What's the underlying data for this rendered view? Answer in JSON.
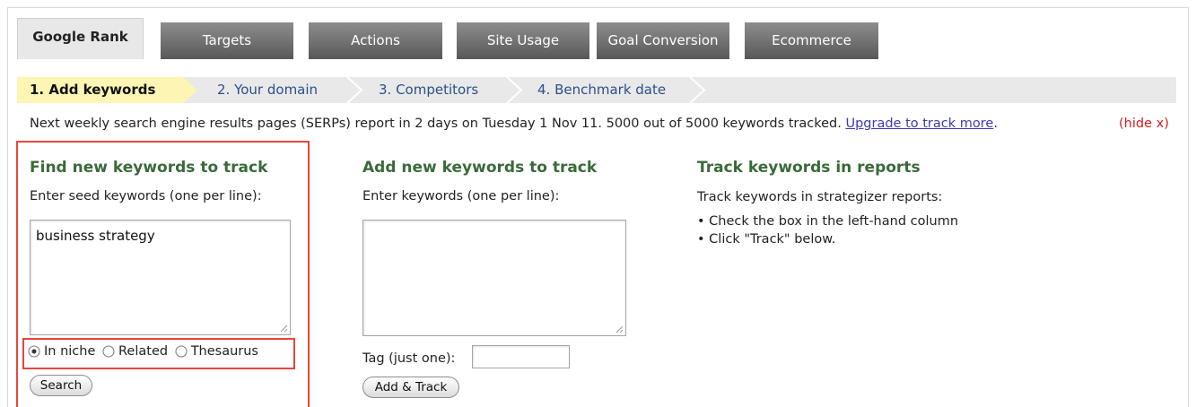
{
  "tabs": [
    {
      "label": "Google Rank",
      "active": true
    },
    {
      "label": "Targets",
      "active": false
    },
    {
      "label": "Actions",
      "active": false
    },
    {
      "label": "Site Usage",
      "active": false
    },
    {
      "label": "Goal Conversion",
      "active": false
    },
    {
      "label": "Ecommerce",
      "active": false
    }
  ],
  "steps": [
    {
      "label": "1. Add keywords",
      "active": true
    },
    {
      "label": "2. Your domain",
      "active": false
    },
    {
      "label": "3. Competitors",
      "active": false
    },
    {
      "label": "4. Benchmark date",
      "active": false
    }
  ],
  "notice": {
    "text": "Next weekly search engine results pages (SERPs) report in 2 days on Tuesday 1 Nov 11. 5000 out of 5000 keywords tracked.",
    "link": "Upgrade to track more",
    "trailing": ".",
    "hide": "(hide x)"
  },
  "find": {
    "title": "Find new keywords to track",
    "label": "Enter seed keywords (one per line):",
    "value": "business strategy",
    "options": [
      "In niche",
      "Related",
      "Thesaurus"
    ],
    "selected": "In niche",
    "button": "Search"
  },
  "add": {
    "title": "Add new keywords to track",
    "label": "Enter keywords (one per line):",
    "value": "",
    "tag_label": "Tag (just one):",
    "tag_value": "",
    "button": "Add & Track"
  },
  "track": {
    "title": "Track keywords in reports",
    "intro": "Track keywords in strategizer reports:",
    "bullets": [
      "• Check the box in the left-hand column",
      "• Click \"Track\" below."
    ]
  },
  "colors": {
    "accent_green": "#3a6a3a",
    "highlight": "#e8453c",
    "link": "#3a3ab0",
    "hide": "#d0201f",
    "step_active_bg": "#fdf5b3"
  }
}
